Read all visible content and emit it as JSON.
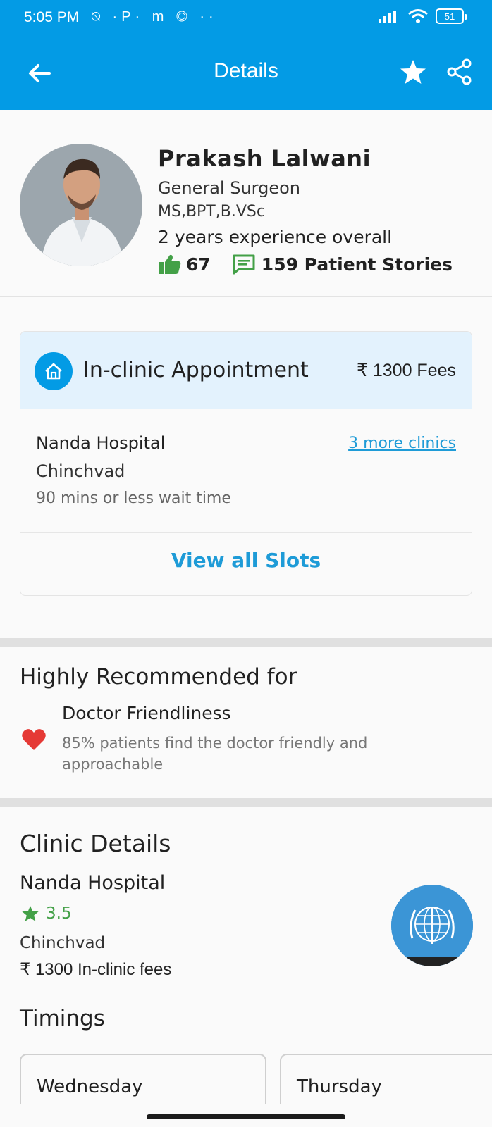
{
  "status_bar": {
    "time": "5:05 PM",
    "notification_icons": "⍉ ·P· m ◎ ··",
    "battery": "51"
  },
  "app_bar": {
    "title": "Details",
    "back_icon": "arrow-left-icon",
    "favorite_icon": "star-icon",
    "share_icon": "share-icon"
  },
  "doctor": {
    "name": "Prakash Lalwani",
    "specialty": "General Surgeon",
    "qualifications": "MS,BPT,B.VSc",
    "experience": "2 years experience overall",
    "likes": "67",
    "stories": "159 Patient Stories"
  },
  "appointment": {
    "type": "In-clinic Appointment",
    "fee": "₹ 1300 Fees",
    "clinic_name": "Nanda Hospital",
    "more_clinics": "3 more clinics",
    "area": "Chinchvad",
    "wait_time": "90 mins or less wait time",
    "view_slots": "View all Slots"
  },
  "recommended": {
    "title": "Highly Recommended for",
    "items": [
      {
        "title": "Doctor Friendliness",
        "description": "85% patients find the doctor friendly and approachable"
      }
    ]
  },
  "clinic_details": {
    "title": "Clinic Details",
    "name": "Nanda Hospital",
    "rating": "3.5",
    "area": "Chinchvad",
    "fees": "₹ 1300 In-clinic fees"
  },
  "timings": {
    "title": "Timings",
    "days": [
      "Wednesday",
      "Thursday"
    ]
  },
  "colors": {
    "primary": "#039be5",
    "link": "#1e9bd7",
    "appointment_header": "#e3f2fd",
    "like_green": "#43a047",
    "heart_red": "#e53935"
  }
}
